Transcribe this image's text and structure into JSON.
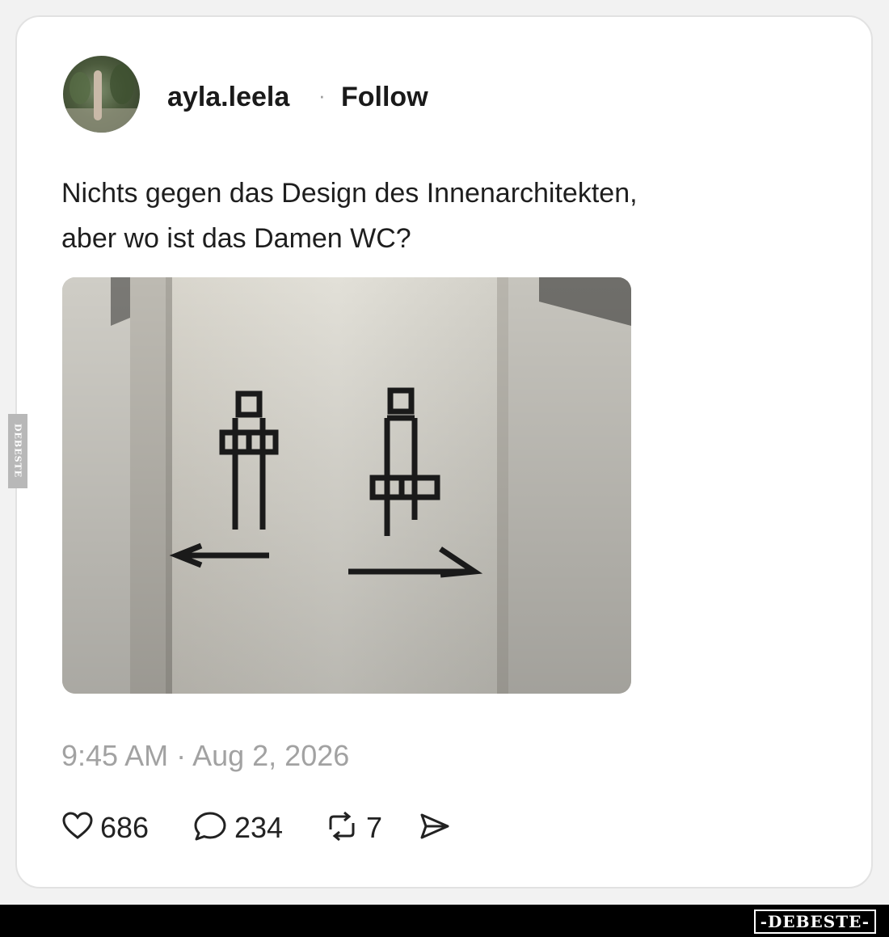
{
  "post": {
    "username": "ayla.leela",
    "separator": "·",
    "follow_label": "Follow",
    "text_line1": "Nichts gegen das Design des Innenarchitekten,",
    "text_line2": "aber wo ist das Damen WC?",
    "timestamp": "9:45 AM · Aug 2, 2026",
    "likes": "686",
    "replies": "234",
    "reposts": "7"
  },
  "icons": {
    "like": "heart-icon",
    "reply": "speech-bubble-icon",
    "repost": "repost-arrows-icon",
    "share": "send-icon"
  },
  "watermark": {
    "side": "DEBESTE",
    "bottom": "-DEBESTE-"
  },
  "colors": {
    "text": "#1e1e1e",
    "muted": "#a2a2a2",
    "card": "#ffffff"
  }
}
